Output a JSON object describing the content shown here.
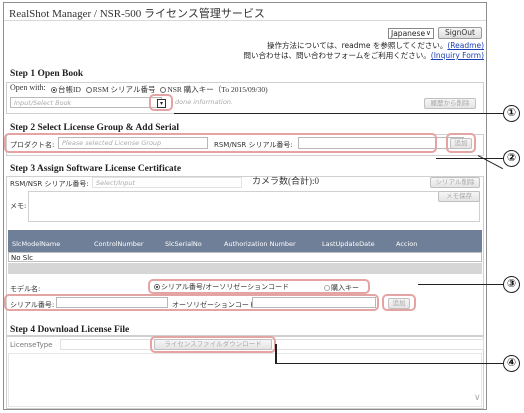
{
  "header": {
    "title": "RealShot Manager / NSR-500 ライセンス管理サービス",
    "language": "Japanese",
    "sign_out": "SignOut",
    "note_line1": "操作方法については、readme を参照してください。",
    "readme_link": "(Readme)",
    "note_line2": "問い合わせは、問い合わせフォームをご利用ください。",
    "inquiry_link": "(Inquiry Form)"
  },
  "step1": {
    "heading": "Step 1 Open Book",
    "open_with_label": "Open with:",
    "radio_options": [
      "台帳ID",
      "RSM シリアル番号",
      "NSR 購入キー（To 2015/09/30)"
    ],
    "input_placeholder": "Input/Select Book",
    "info_placeholder": "done information.",
    "history_button": "履歴から削除"
  },
  "step2": {
    "heading": "Step 2 Select License Group & Add Serial",
    "product_label": "プロダクト名:",
    "product_placeholder": "Please selected License Group",
    "serial_label": "RSM/NSR シリアル番号:",
    "add_button": "追加"
  },
  "step3": {
    "heading": "Step 3 Assign Software License Certificate",
    "serial_label": "RSM/NSR シリアル番号:",
    "serial_placeholder": "Select/Input",
    "camera_count": "カメラ数(合計):0",
    "delete_serial_button": "シリアル削除",
    "memo_label": "メモ:",
    "save_memo_button": "メモ保存",
    "table_columns": [
      "SlcModelName",
      "ControlNumber",
      "SlcSerialNo",
      "Authorization Number",
      "LastUpdateDate",
      "Accion"
    ],
    "table_empty": "No Slc",
    "model_label": "モデル名:",
    "radio_options": [
      "シリアル番号/オーソリゼーションコード",
      "購入キー"
    ],
    "serial_no_label": "シリアル番号:",
    "auth_code_label": "オーソリゼーションコード:",
    "add_button": "追加"
  },
  "step4": {
    "heading": "Step 4 Download License File",
    "license_type_label": "LicenseType",
    "download_button": "ライセンスファイルダウンロード"
  },
  "callouts": [
    "①",
    "②",
    "③",
    "④"
  ]
}
